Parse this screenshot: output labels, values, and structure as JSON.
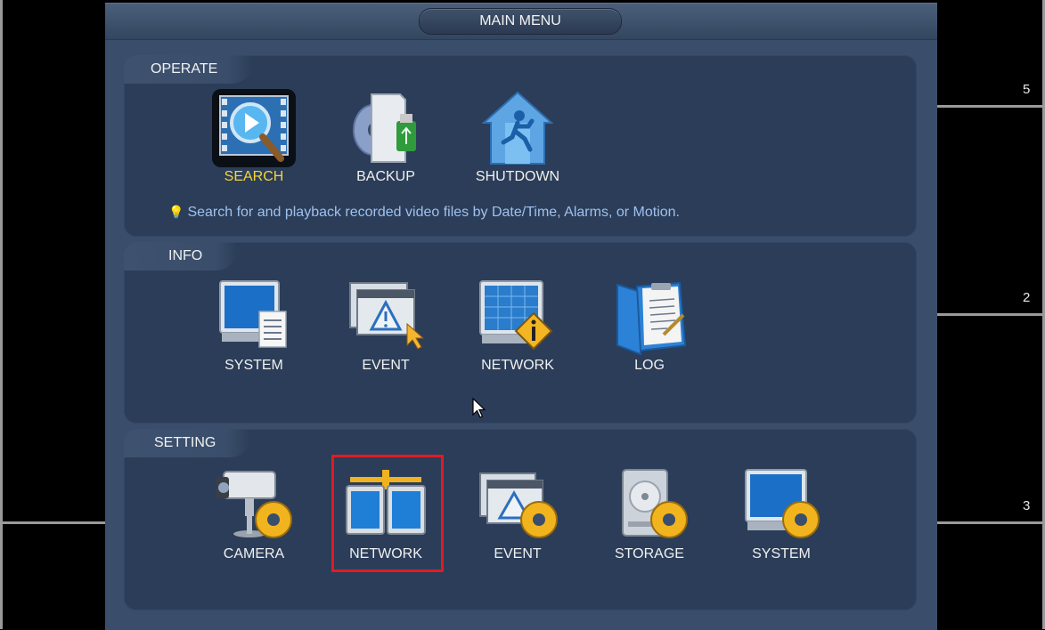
{
  "window": {
    "title": "MAIN MENU"
  },
  "background": {
    "camera_numbers": [
      "5",
      "2",
      "3"
    ]
  },
  "operate": {
    "label": "OPERATE",
    "items": [
      {
        "label": "SEARCH",
        "icon": "search-video-icon",
        "selected": true
      },
      {
        "label": "BACKUP",
        "icon": "backup-usb-icon"
      },
      {
        "label": "SHUTDOWN",
        "icon": "shutdown-exit-icon"
      }
    ],
    "hint": "Search for and playback recorded video files by Date/Time, Alarms, or Motion."
  },
  "info": {
    "label": "INFO",
    "items": [
      {
        "label": "SYSTEM",
        "icon": "system-info-icon"
      },
      {
        "label": "EVENT",
        "icon": "event-warning-icon"
      },
      {
        "label": "NETWORK",
        "icon": "network-info-icon"
      },
      {
        "label": "LOG",
        "icon": "log-notebook-icon"
      }
    ]
  },
  "setting": {
    "label": "SETTING",
    "items": [
      {
        "label": "CAMERA",
        "icon": "camera-settings-icon"
      },
      {
        "label": "NETWORK",
        "icon": "network-settings-icon",
        "highlighted": true
      },
      {
        "label": "EVENT",
        "icon": "event-settings-icon"
      },
      {
        "label": "STORAGE",
        "icon": "storage-settings-icon"
      },
      {
        "label": "SYSTEM",
        "icon": "system-settings-icon"
      }
    ]
  },
  "colors": {
    "highlight_border": "#e01b24",
    "selected_label": "#f5d53a",
    "hint_text": "#9fc0ee"
  }
}
